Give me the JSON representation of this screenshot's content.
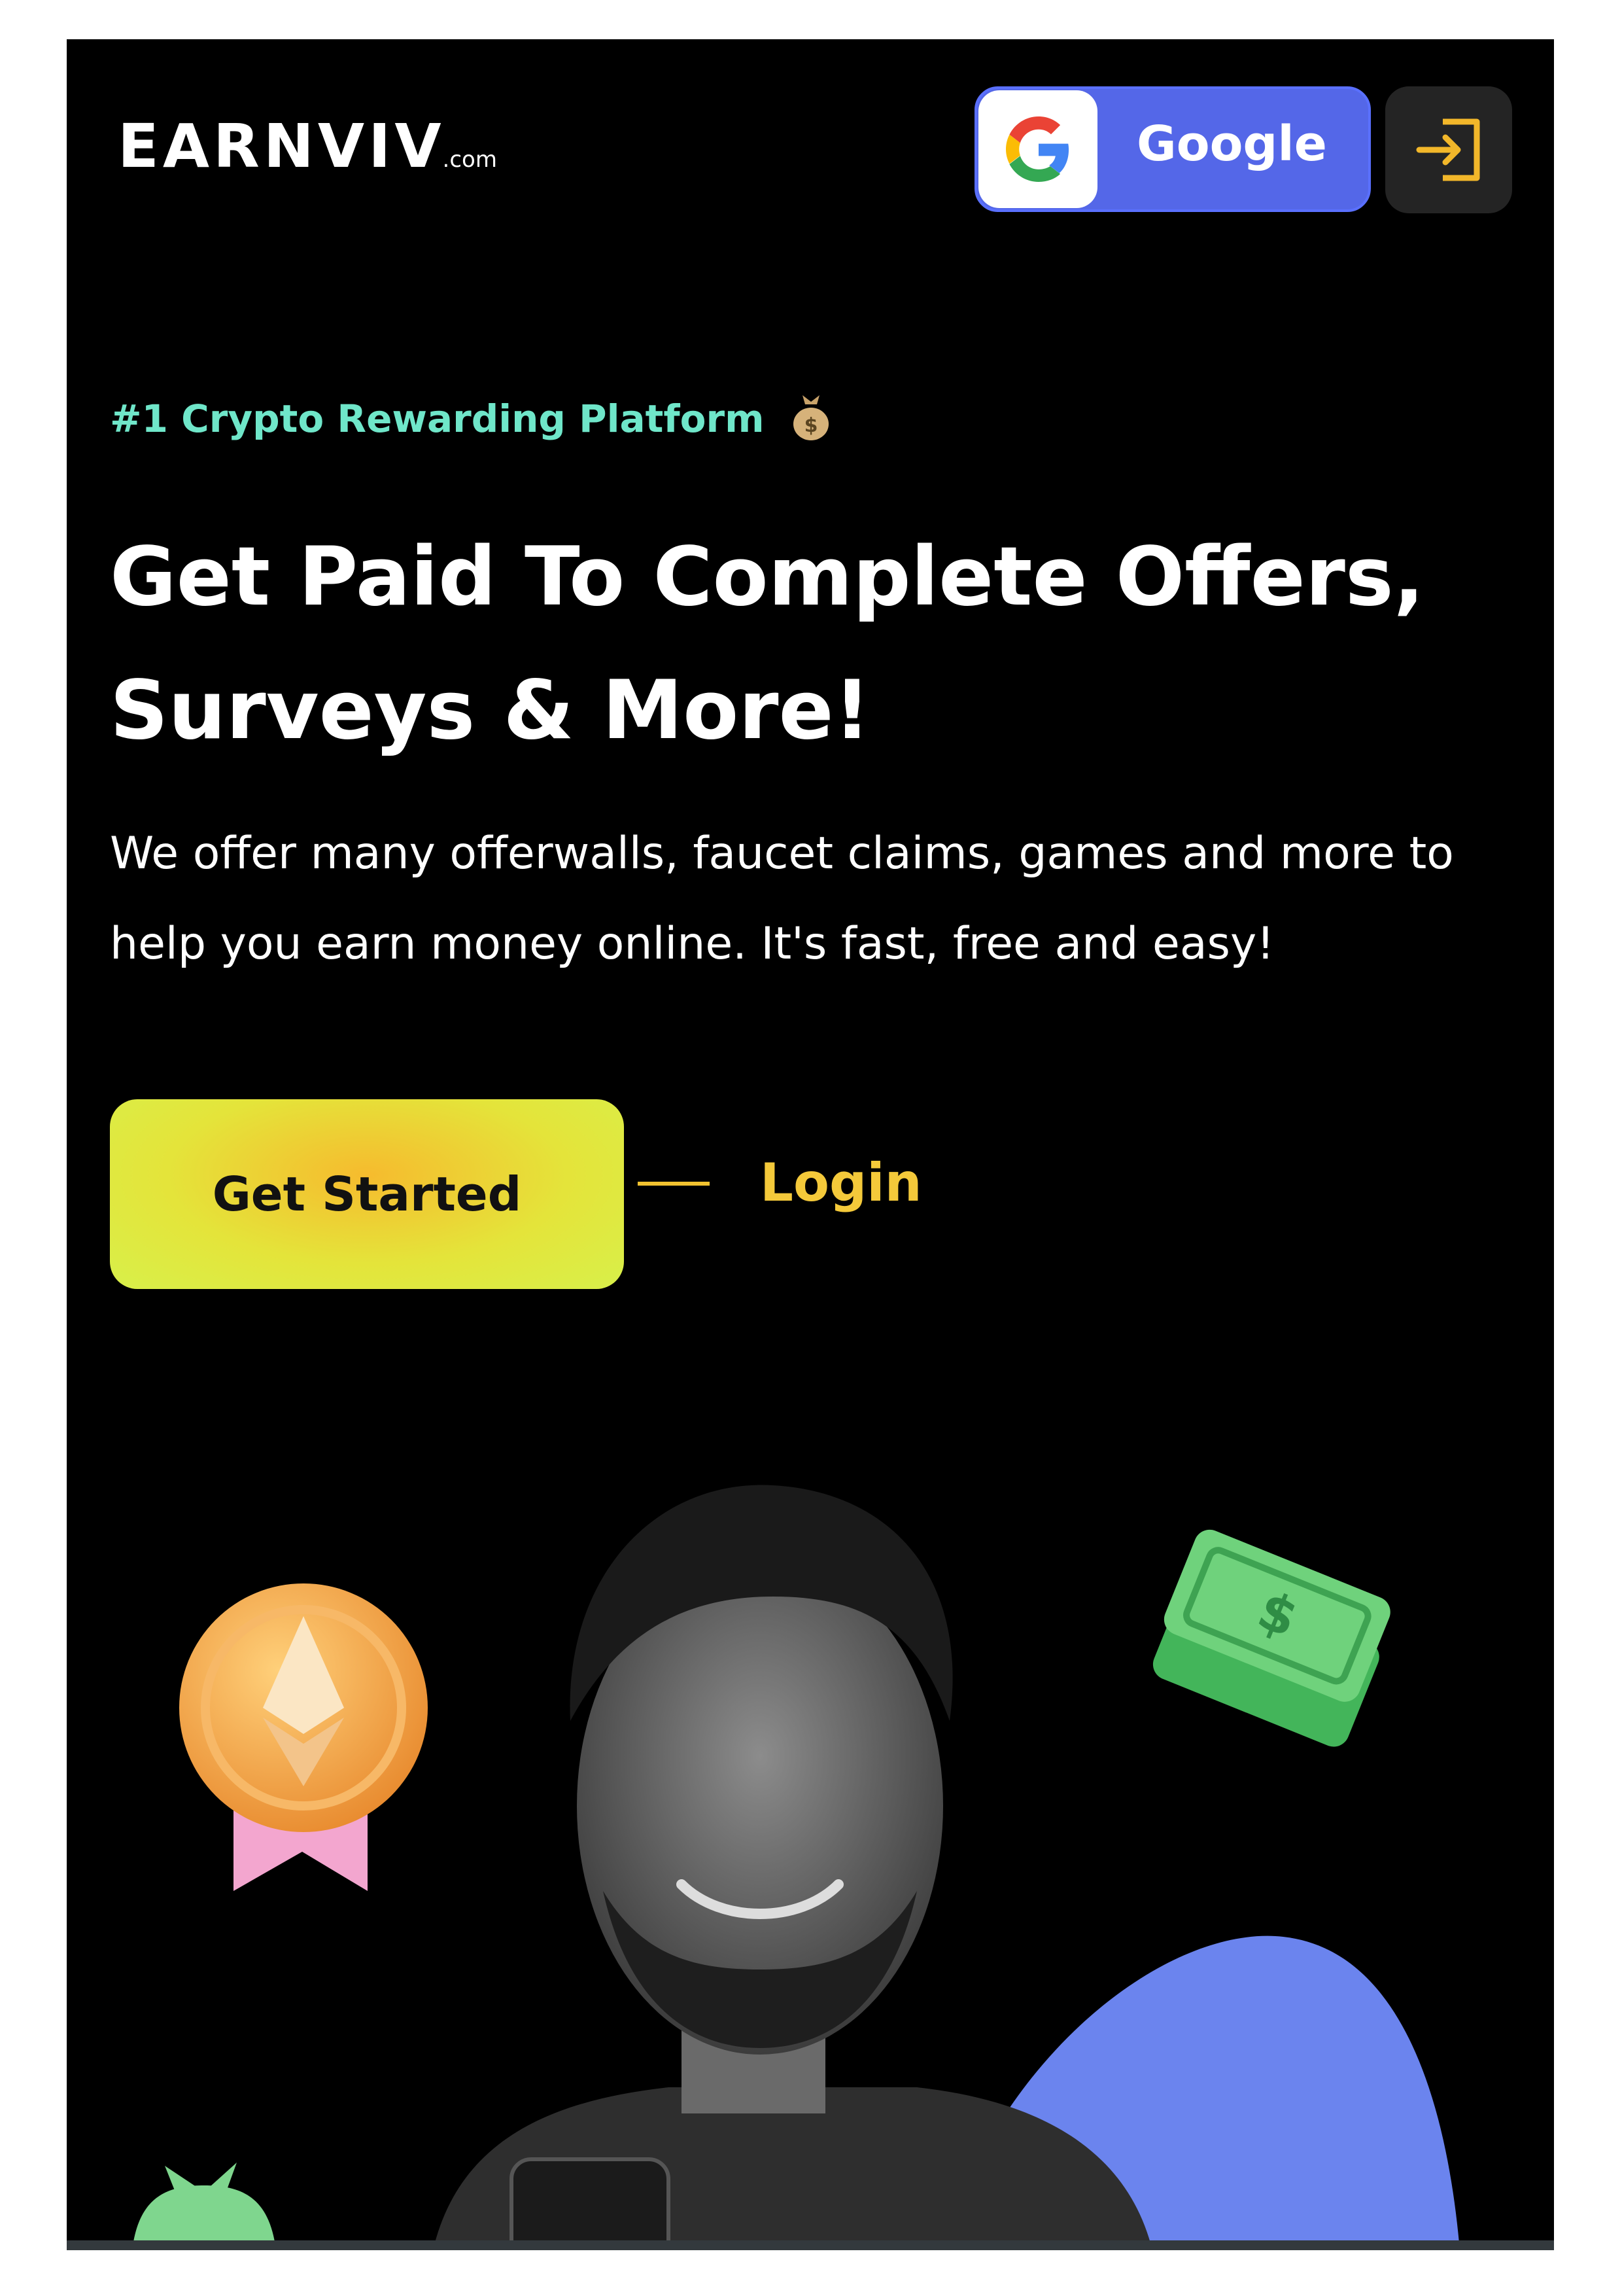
{
  "header": {
    "logo_text": "EARNVIV",
    "logo_suffix": ".com",
    "google_button_label": "Google",
    "login_icon": "sign-in-icon"
  },
  "hero": {
    "tagline": "#1 Crypto Rewarding Platform",
    "tagline_icon": "money-bag-icon",
    "headline_line1": "Get Paid To Complete Offers,",
    "headline_line2": "Surveys & More!",
    "subtext": "We offer many offerwalls, faucet claims, games and more to help you earn money online. It's fast, free and easy!",
    "cta_label": "Get Started",
    "login_label": "Login"
  },
  "colors": {
    "background": "#000000",
    "tagline": "#6fe6c9",
    "google_button": "#5467e8",
    "cta_gradient_center": "#f6bb2e",
    "cta_gradient_edge": "#d8f04a",
    "login_link": "#f4c93a",
    "blob": "#6b84ee"
  },
  "illustration": {
    "elements": [
      "ethereum-medal-icon",
      "dollar-bills-icon",
      "smiling-man-with-phone",
      "blue-blob",
      "money-bag-icon"
    ]
  }
}
